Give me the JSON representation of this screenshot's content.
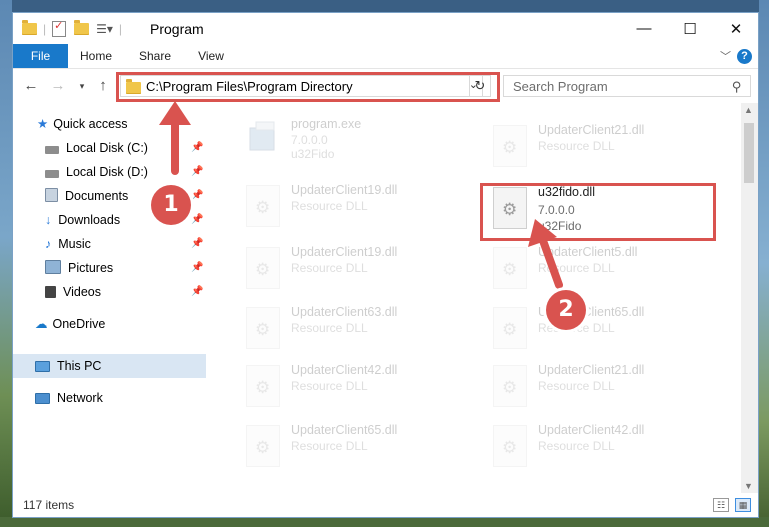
{
  "window": {
    "title": "Program",
    "controls": {
      "minimize": "—",
      "maximize": "☐",
      "close": "✕"
    }
  },
  "ribbon": {
    "tabs": [
      "File",
      "Home",
      "Share",
      "View"
    ],
    "help": "?"
  },
  "navbar": {
    "address": "C:\\Program Files\\Program Directory",
    "search_placeholder": "Search Program"
  },
  "sidebar": {
    "quick_access": "Quick access",
    "items": [
      "Local Disk (C:)",
      "Local Disk (D:)",
      "Documents",
      "Downloads",
      "Music",
      "Pictures",
      "Videos"
    ],
    "onedrive": "OneDrive",
    "this_pc": "This PC",
    "network": "Network"
  },
  "files": [
    {
      "name": "program.exe",
      "line2": "7.0.0.0",
      "line3": "u32Fido"
    },
    {
      "name": "UpdaterClient21.dll",
      "line2": "Resource DLL"
    },
    {
      "name": "UpdaterClient19.dll",
      "line2": "Resource DLL"
    },
    {
      "name": "u32fido.dll",
      "line2": "7.0.0.0",
      "line3": "u32Fido"
    },
    {
      "name": "UpdaterClient19.dll",
      "line2": "Resource DLL"
    },
    {
      "name": "UpdaterClient5.dll",
      "line2": "Resource DLL"
    },
    {
      "name": "UpdaterClient63.dll",
      "line2": "Resource DLL"
    },
    {
      "name": "UpdaterClient65.dll",
      "line2": "Resource DLL"
    },
    {
      "name": "UpdaterClient42.dll",
      "line2": "Resource DLL"
    },
    {
      "name": "UpdaterClient21.dll",
      "line2": "Resource DLL"
    },
    {
      "name": "UpdaterClient65.dll",
      "line2": "Resource DLL"
    },
    {
      "name": "UpdaterClient42.dll",
      "line2": "Resource DLL"
    }
  ],
  "status": {
    "item_count": "117 items"
  },
  "annotations": {
    "step1": "1",
    "step2": "2",
    "color": "#d9534f"
  }
}
